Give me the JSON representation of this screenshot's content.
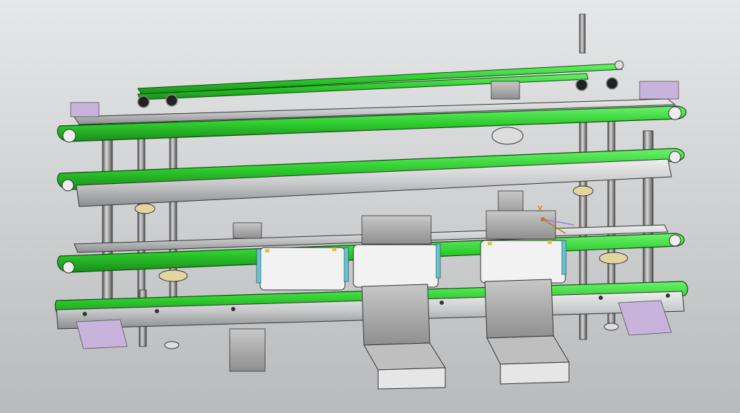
{
  "viewport": {
    "background_top": "#e6e7e8",
    "background_bottom": "#b9babc"
  },
  "colors": {
    "belt_green": "#2ecc2e",
    "belt_green_dark": "#1c8f1c",
    "belt_green_light": "#62e962",
    "rail_gray": "#c9cacb",
    "rail_gray_dark": "#8d8e90",
    "mount_purple": "#c7b3dc",
    "block_gray": "#a9aaab",
    "pocket_white": "#f2f2f2",
    "bearing_gold": "#e3d4a0",
    "accent_cyan": "#5fc6d6",
    "accent_yellow": "#e0c440"
  },
  "triad": {
    "x_label": "X",
    "icon": "coordinate-triad-icon"
  }
}
